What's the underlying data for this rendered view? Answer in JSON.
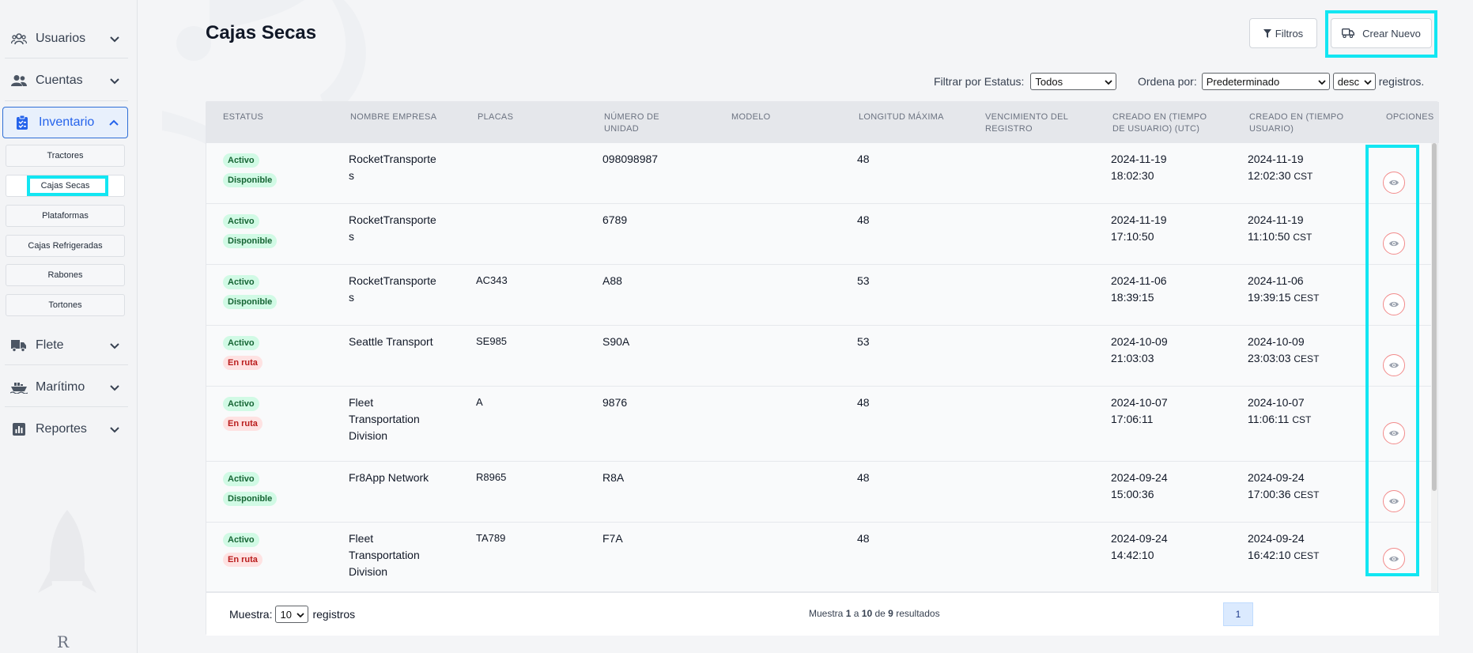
{
  "sidebar": {
    "items": [
      {
        "label": "Usuarios",
        "icon": "users-icon"
      },
      {
        "label": "Cuentas",
        "icon": "accounts-icon"
      },
      {
        "label": "Inventario",
        "icon": "clipboard-icon"
      },
      {
        "label": "Flete",
        "icon": "truck-icon"
      },
      {
        "label": "Marítimo",
        "icon": "ship-icon"
      },
      {
        "label": "Reportes",
        "icon": "chart-icon"
      }
    ],
    "subitems": [
      "Tractores",
      "Cajas Secas",
      "Plataformas",
      "Cajas Refrigeradas",
      "Rabones",
      "Tortones"
    ],
    "logo": "R"
  },
  "header": {
    "title": "Cajas Secas",
    "filters_label": "Filtros",
    "create_label": "Crear Nuevo"
  },
  "filters": {
    "status_label": "Filtrar por Estatus:",
    "status_value": "Todos",
    "order_label": "Ordena por:",
    "order_value": "Predeterminado",
    "dir_value": "desc",
    "records_suffix": "registros."
  },
  "table": {
    "columns": [
      [
        "ESTATUS",
        ""
      ],
      [
        "NOMBRE EMPRESA",
        ""
      ],
      [
        "PLACAS",
        ""
      ],
      [
        "NÚMERO DE",
        "UNIDAD"
      ],
      [
        "MODELO",
        ""
      ],
      [
        "LONGITUD MÁXIMA",
        ""
      ],
      [
        "VENCIMIENTO DEL",
        "REGISTRO"
      ],
      [
        "CREADO EN (TIEMPO",
        "DE USUARIO) (UTC)"
      ],
      [
        "CREADO EN (TIEMPO",
        "USUARIO)"
      ],
      [
        "OPCIONES",
        ""
      ]
    ],
    "rows": [
      {
        "status": "Activo",
        "availability": "Disponible",
        "company": [
          "RocketTransporte",
          "s"
        ],
        "plates": "",
        "unit": "098098987",
        "model": "",
        "length": "48",
        "expiry": "",
        "utc_date": "2024-11-19",
        "utc_time": "18:02:30",
        "local_date": "2024-11-19",
        "local_time": "12:02:30",
        "tz": "CST"
      },
      {
        "status": "Activo",
        "availability": "Disponible",
        "company": [
          "RocketTransporte",
          "s"
        ],
        "plates": "",
        "unit": "6789",
        "model": "",
        "length": "48",
        "expiry": "",
        "utc_date": "2024-11-19",
        "utc_time": "17:10:50",
        "local_date": "2024-11-19",
        "local_time": "11:10:50",
        "tz": "CST"
      },
      {
        "status": "Activo",
        "availability": "Disponible",
        "company": [
          "RocketTransporte",
          "s"
        ],
        "plates": "AC343",
        "unit": "A88",
        "model": "",
        "length": "53",
        "expiry": "",
        "utc_date": "2024-11-06",
        "utc_time": "18:39:15",
        "local_date": "2024-11-06",
        "local_time": "19:39:15",
        "tz": "CEST"
      },
      {
        "status": "Activo",
        "availability": "En ruta",
        "company": [
          "Seattle Transport"
        ],
        "plates": "SE985",
        "unit": "S90A",
        "model": "",
        "length": "53",
        "expiry": "",
        "utc_date": "2024-10-09",
        "utc_time": "21:03:03",
        "local_date": "2024-10-09",
        "local_time": "23:03:03",
        "tz": "CEST"
      },
      {
        "status": "Activo",
        "availability": "En ruta",
        "company": [
          "Fleet",
          "Transportation",
          "Division"
        ],
        "plates": "A",
        "unit": "9876",
        "model": "",
        "length": "48",
        "expiry": "",
        "utc_date": "2024-10-07",
        "utc_time": "17:06:11",
        "local_date": "2024-10-07",
        "local_time": "11:06:11",
        "tz": "CST"
      },
      {
        "status": "Activo",
        "availability": "Disponible",
        "company": [
          "Fr8App Network"
        ],
        "plates": "R8965",
        "unit": "R8A",
        "model": "",
        "length": "48",
        "expiry": "",
        "utc_date": "2024-09-24",
        "utc_time": "15:00:36",
        "local_date": "2024-09-24",
        "local_time": "17:00:36",
        "tz": "CEST"
      },
      {
        "status": "Activo",
        "availability": "En ruta",
        "company": [
          "Fleet",
          "Transportation",
          "Division"
        ],
        "plates": "TA789",
        "unit": "F7A",
        "model": "",
        "length": "48",
        "expiry": "",
        "utc_date": "2024-09-24",
        "utc_time": "14:42:10",
        "local_date": "2024-09-24",
        "local_time": "16:42:10",
        "tz": "CEST"
      }
    ]
  },
  "footer": {
    "show_label": "Muestra:",
    "page_size": "10",
    "show_suffix": "registros",
    "summary_prefix": "Muestra",
    "from": "1",
    "a": "a",
    "to": "10",
    "de": "de",
    "total": "9",
    "summary_suffix": "resultados",
    "current_page": "1"
  },
  "colors": {
    "highlight": "#12e6f2",
    "active_nav": "#2563eb",
    "badge_green_bg": "#d1fae5",
    "badge_red_bg": "#fee2e2"
  }
}
